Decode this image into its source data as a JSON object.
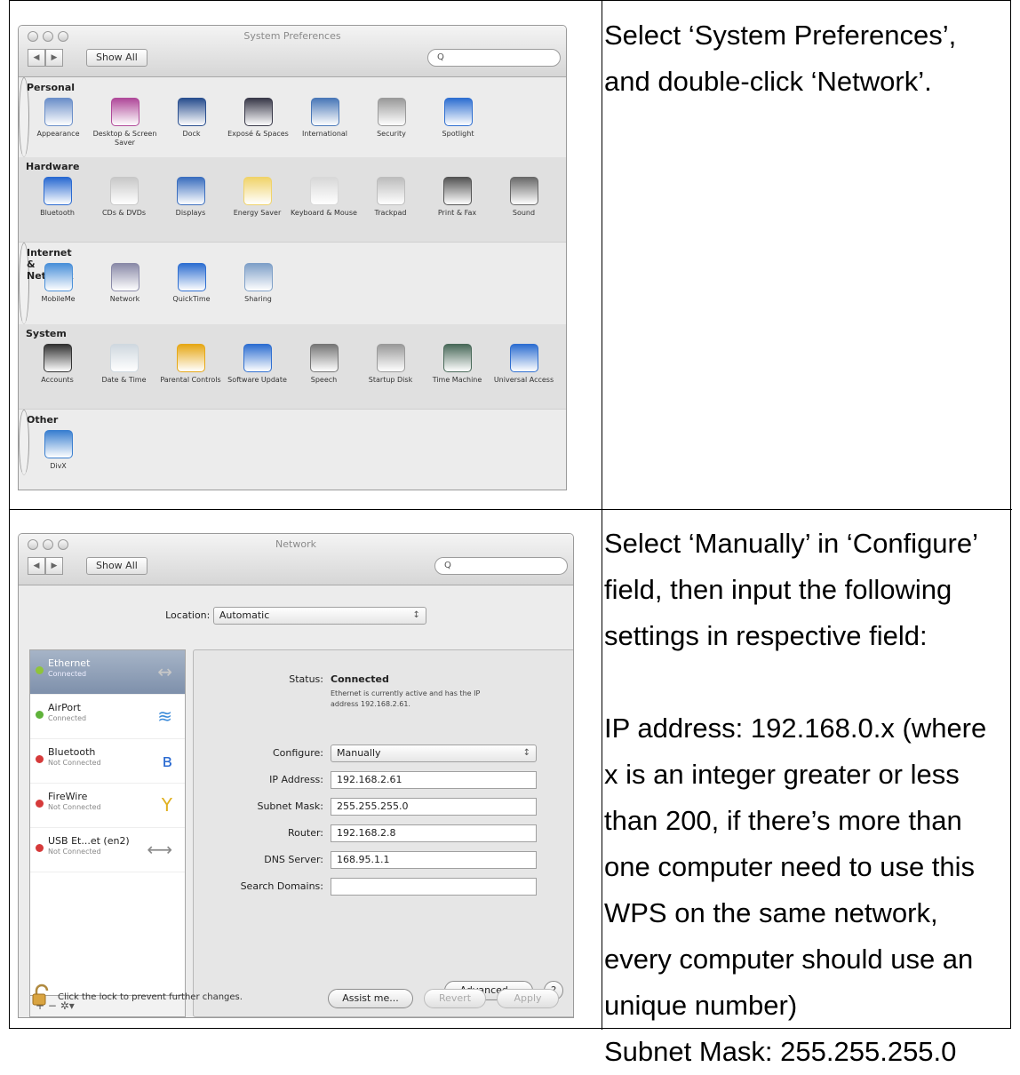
{
  "doc": {
    "step1_text": [
      "Select ‘System Preferences’,",
      "and double-click ‘Network’."
    ],
    "step2_text": [
      "Select ‘Manually’ in ‘Configure’",
      "field, then input the following",
      "settings in respective field:",
      "",
      "IP address: 192.168.0.x (where",
      "x is an integer greater or less",
      "than 200, if there’s more than",
      "one computer need to use this",
      "WPS on the same network,",
      "every computer should use an",
      "unique number)",
      "Subnet Mask: 255.255.255.0"
    ]
  },
  "sysprefs": {
    "title": "System Preferences",
    "show_all": "Show All",
    "search_icon_glyph": "Q",
    "sections": [
      {
        "name": "Personal",
        "items": [
          {
            "label": "Appearance",
            "icon": "appearance-icon",
            "color": "#6b8fc9"
          },
          {
            "label": "Desktop & Screen Saver",
            "icon": "desktop-icon",
            "color": "#b04a9a"
          },
          {
            "label": "Dock",
            "icon": "dock-icon",
            "color": "#2a4f8f"
          },
          {
            "label": "Exposé & Spaces",
            "icon": "expose-icon",
            "color": "#3a3a4a"
          },
          {
            "label": "International",
            "icon": "international-icon",
            "color": "#4a78b8"
          },
          {
            "label": "Security",
            "icon": "security-icon",
            "color": "#9a9a9a"
          },
          {
            "label": "Spotlight",
            "icon": "spotlight-icon",
            "color": "#2f6fd1"
          }
        ]
      },
      {
        "name": "Hardware",
        "items": [
          {
            "label": "Bluetooth",
            "icon": "bluetooth-icon",
            "color": "#2a6ad1"
          },
          {
            "label": "CDs & DVDs",
            "icon": "cd-icon",
            "color": "#c8c8c8"
          },
          {
            "label": "Displays",
            "icon": "displays-icon",
            "color": "#3c6fbf"
          },
          {
            "label": "Energy Saver",
            "icon": "energy-icon",
            "color": "#f0d36a"
          },
          {
            "label": "Keyboard & Mouse",
            "icon": "keyboard-icon",
            "color": "#d8d8d8"
          },
          {
            "label": "Trackpad",
            "icon": "trackpad-icon",
            "color": "#bdbdbd"
          },
          {
            "label": "Print & Fax",
            "icon": "print-icon",
            "color": "#555555"
          },
          {
            "label": "Sound",
            "icon": "sound-icon",
            "color": "#6a6a6a"
          }
        ]
      },
      {
        "name": "Internet & Network",
        "items": [
          {
            "label": "MobileMe",
            "icon": "mobileme-icon",
            "color": "#4a90d9"
          },
          {
            "label": "Network",
            "icon": "network-icon",
            "color": "#8a8aa8"
          },
          {
            "label": "QuickTime",
            "icon": "quicktime-icon",
            "color": "#2f6fd1"
          },
          {
            "label": "Sharing",
            "icon": "sharing-icon",
            "color": "#7fa0c8"
          }
        ]
      },
      {
        "name": "System",
        "items": [
          {
            "label": "Accounts",
            "icon": "accounts-icon",
            "color": "#333333"
          },
          {
            "label": "Date & Time",
            "icon": "clock-icon",
            "color": "#cfd8df"
          },
          {
            "label": "Parental Controls",
            "icon": "parental-icon",
            "color": "#e6a817"
          },
          {
            "label": "Software Update",
            "icon": "update-icon",
            "color": "#2f6fd1"
          },
          {
            "label": "Speech",
            "icon": "microphone-icon",
            "color": "#777777"
          },
          {
            "label": "Startup Disk",
            "icon": "disk-icon",
            "color": "#9a9a9a"
          },
          {
            "label": "Time Machine",
            "icon": "timemachine-icon",
            "color": "#4a6a5a"
          },
          {
            "label": "Universal Access",
            "icon": "access-icon",
            "color": "#2f6fd1"
          }
        ]
      },
      {
        "name": "Other",
        "items": [
          {
            "label": "DivX",
            "icon": "divx-icon",
            "color": "#3a7fd0"
          }
        ]
      }
    ]
  },
  "network": {
    "title": "Network",
    "show_all": "Show All",
    "search_icon_glyph": "Q",
    "location_label": "Location:",
    "location_value": "Automatic",
    "interfaces": [
      {
        "name": "Ethernet",
        "status": "Connected",
        "dot_color": "#8fc43a",
        "icon": "↔"
      },
      {
        "name": "AirPort",
        "status": "Connected",
        "dot_color": "#5fb23a",
        "icon": "≋"
      },
      {
        "name": "Bluetooth",
        "status": "Not Connected",
        "dot_color": "#d63a3a",
        "icon": "ʙ"
      },
      {
        "name": "FireWire",
        "status": "Not Connected",
        "dot_color": "#d63a3a",
        "icon": "Y"
      },
      {
        "name": "USB Et...et (en2)",
        "status": "Not Connected",
        "dot_color": "#d63a3a",
        "icon": "⟷"
      }
    ],
    "list_controls": "+   −   ✲▾",
    "status_label": "Status:",
    "status_value": "Connected",
    "status_desc_1": "Ethernet is currently active and has the IP",
    "status_desc_2": "address 192.168.2.61.",
    "configure_label": "Configure:",
    "configure_value": "Manually",
    "ip_label": "IP Address:",
    "ip_value": "192.168.2.61",
    "mask_label": "Subnet Mask:",
    "mask_value": "255.255.255.0",
    "router_label": "Router:",
    "router_value": "192.168.2.8",
    "dns_label": "DNS Server:",
    "dns_value": "168.95.1.1",
    "search_domains_label": "Search Domains:",
    "search_domains_value": "",
    "advanced_btn": "Advanced...",
    "help_btn": "?",
    "lock_text": "Click the lock to prevent further changes.",
    "assist_btn": "Assist me...",
    "revert_btn": "Revert",
    "apply_btn": "Apply"
  }
}
